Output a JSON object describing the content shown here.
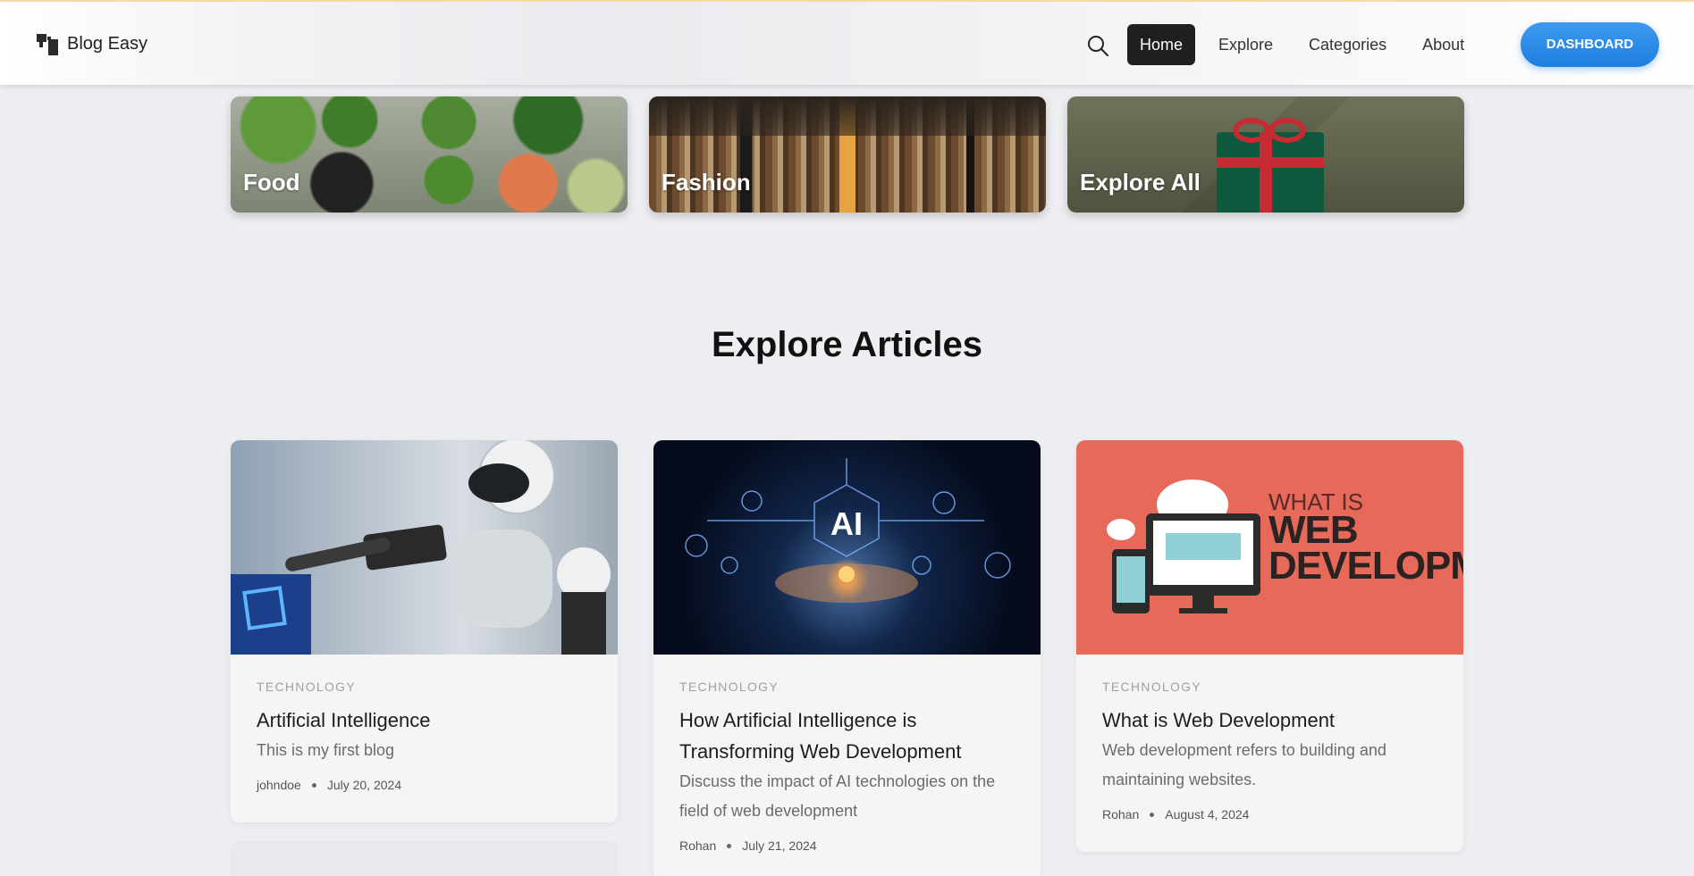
{
  "header": {
    "brand": "Blog Easy",
    "nav": [
      {
        "label": "Home",
        "active": true
      },
      {
        "label": "Explore",
        "active": false
      },
      {
        "label": "Categories",
        "active": false
      },
      {
        "label": "About",
        "active": false
      }
    ],
    "dashboard_label": "DASHBOARD",
    "accent_color": "#1f7fe0"
  },
  "categories": [
    {
      "label": "Food"
    },
    {
      "label": "Fashion"
    },
    {
      "label": "Explore All"
    }
  ],
  "section_title": "Explore Articles",
  "articles": [
    {
      "category": "TECHNOLOGY",
      "title": "Artificial Intelligence",
      "description": "This is my first blog",
      "author": "johndoe",
      "date": "July 20, 2024"
    },
    {
      "category": "TECHNOLOGY",
      "title": "How Artificial Intelligence is Transforming Web Development",
      "description": "Discuss the impact of AI technologies on the field of web development",
      "author": "Rohan",
      "date": "July 21, 2024"
    },
    {
      "category": "TECHNOLOGY",
      "title": "What is Web Development",
      "description": "Web development refers to building and maintaining websites.",
      "author": "Rohan",
      "date": "August 4, 2024"
    }
  ],
  "thumb_texts": {
    "ai_label": "AI",
    "web_small": "WHAT IS",
    "web_line1": "WEB",
    "web_line2": "DEVELOPMENT"
  }
}
